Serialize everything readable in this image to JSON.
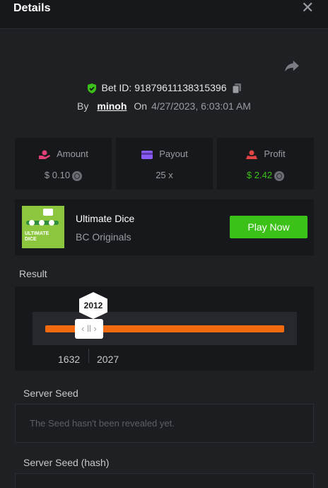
{
  "header": {
    "title": "Details"
  },
  "bet": {
    "id_text": "Bet ID: 91879611138315396",
    "by_label": "By",
    "user": "minoh",
    "on_label": "On",
    "date": "4/27/2023, 6:03:01 AM"
  },
  "stats": {
    "amount": {
      "label": "Amount",
      "value": "$ 0.10"
    },
    "payout": {
      "label": "Payout",
      "value": "25 x"
    },
    "profit": {
      "label": "Profit",
      "value": "$ 2.42"
    }
  },
  "game": {
    "name": "Ultimate Dice",
    "provider": "BC Originals",
    "play_label": "Play Now",
    "thumb_text": "ULTIMATE DICE"
  },
  "result": {
    "label": "Result",
    "value": "2012",
    "range_min": "1632",
    "range_max": "2027"
  },
  "server_seed": {
    "label": "Server Seed",
    "placeholder": "The Seed hasn't been revealed yet."
  },
  "server_seed_hash": {
    "label": "Server Seed (hash)"
  },
  "colors": {
    "accent_green": "#3bc117",
    "accent_orange": "#f26a10",
    "amount_icon": "#e2407a",
    "payout_icon": "#8a5cf6",
    "profit_icon": "#e04545"
  },
  "icons": [
    "close-icon",
    "share-icon",
    "shield-check-icon",
    "copy-icon",
    "amount-icon",
    "payout-icon",
    "profit-icon",
    "coin-icon"
  ]
}
